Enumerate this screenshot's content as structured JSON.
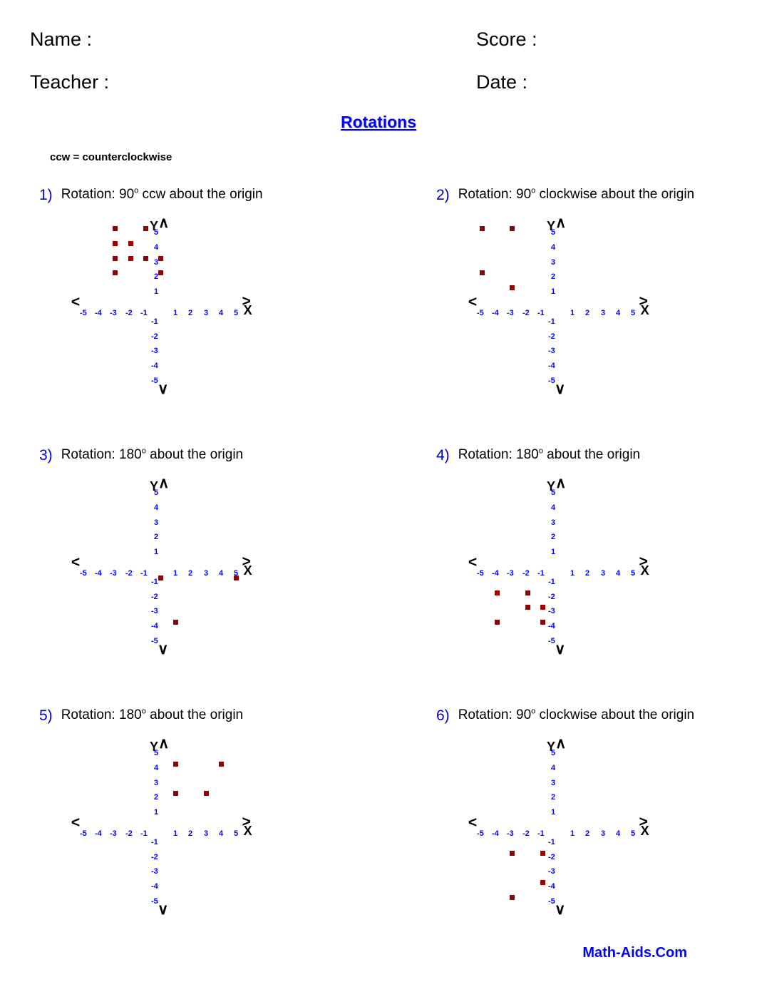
{
  "header": {
    "name_label": "Name :",
    "teacher_label": "Teacher :",
    "score_label": "Score :",
    "date_label": "Date :"
  },
  "title": "Rotations",
  "legend_note": "ccw = counterclockwise",
  "footer": "Math-Aids.Com",
  "colors": {
    "title": "#0000FF",
    "problem_number": "#0000CC",
    "tick_label": "#0000FF",
    "point_marker": "#990000",
    "axis": "#000000",
    "footer": "#0000FF"
  },
  "axis": {
    "x_letter": "X",
    "y_letter": "Y",
    "left_arrow": "<",
    "right_arrow": ">",
    "up_arrow": "∧",
    "down_arrow": "∨",
    "x_ticks": [
      "-5",
      "-4",
      "-3",
      "-2",
      "-1",
      "1",
      "2",
      "3",
      "4",
      "5"
    ],
    "y_ticks": [
      "5",
      "4",
      "3",
      "2",
      "1",
      "-1",
      "-2",
      "-3",
      "-4",
      "-5"
    ],
    "xlim": [
      -5,
      5
    ],
    "ylim": [
      -5,
      5
    ]
  },
  "problems": [
    {
      "number": "1)",
      "prefix": "Rotation: 90",
      "degree": "o",
      "suffix": " ccw about the origin",
      "text": "Rotation: 90° ccw about the origin"
    },
    {
      "number": "2)",
      "prefix": "Rotation: 90",
      "degree": "o",
      "suffix": " clockwise about the origin",
      "text": "Rotation: 90° clockwise about the origin"
    },
    {
      "number": "3)",
      "prefix": "Rotation: 180",
      "degree": "o",
      "suffix": " about the origin",
      "text": "Rotation: 180° about the origin"
    },
    {
      "number": "4)",
      "prefix": "Rotation: 180",
      "degree": "o",
      "suffix": " about the origin",
      "text": "Rotation: 180° about the origin"
    },
    {
      "number": "5)",
      "prefix": "Rotation: 180",
      "degree": "o",
      "suffix": " about the origin",
      "text": "Rotation: 180° about the origin"
    },
    {
      "number": "6)",
      "prefix": "Rotation: 90",
      "degree": "o",
      "suffix": " clockwise about the origin",
      "text": "Rotation: 90° clockwise about the origin"
    }
  ],
  "chart_data": [
    {
      "type": "scatter",
      "title": "Rotation: 90° ccw about the origin",
      "xlabel": "X",
      "ylabel": "Y",
      "xlim": [
        -5,
        5
      ],
      "ylim": [
        -5,
        5
      ],
      "grid": false,
      "legend": "none",
      "marker_color": "#990000",
      "points": [
        [
          -3,
          5
        ],
        [
          -1,
          5
        ],
        [
          -3,
          4
        ],
        [
          -2,
          4
        ],
        [
          -3,
          3
        ],
        [
          -2,
          3
        ],
        [
          -1,
          3
        ],
        [
          0,
          3
        ],
        [
          -3,
          2
        ],
        [
          0,
          2
        ]
      ]
    },
    {
      "type": "scatter",
      "title": "Rotation: 90° clockwise about the origin",
      "xlabel": "X",
      "ylabel": "Y",
      "xlim": [
        -5,
        5
      ],
      "ylim": [
        -5,
        5
      ],
      "grid": false,
      "legend": "none",
      "marker_color": "#990000",
      "points": [
        [
          -5,
          5
        ],
        [
          -3,
          5
        ],
        [
          -5,
          2
        ],
        [
          -3,
          1
        ]
      ]
    },
    {
      "type": "scatter",
      "title": "Rotation: 180° about the origin",
      "xlabel": "X",
      "ylabel": "Y",
      "xlim": [
        -5,
        5
      ],
      "ylim": [
        -5,
        5
      ],
      "grid": false,
      "legend": "none",
      "marker_color": "#990000",
      "points": [
        [
          0,
          -1
        ],
        [
          5,
          -1
        ],
        [
          1,
          -4
        ]
      ]
    },
    {
      "type": "scatter",
      "title": "Rotation: 180° about the origin",
      "xlabel": "X",
      "ylabel": "Y",
      "xlim": [
        -5,
        5
      ],
      "ylim": [
        -5,
        5
      ],
      "grid": false,
      "legend": "none",
      "marker_color": "#990000",
      "points": [
        [
          -4,
          -2
        ],
        [
          -2,
          -2
        ],
        [
          -2,
          -3
        ],
        [
          -1,
          -3
        ],
        [
          -4,
          -4
        ],
        [
          -1,
          -4
        ]
      ]
    },
    {
      "type": "scatter",
      "title": "Rotation: 180° about the origin",
      "xlabel": "X",
      "ylabel": "Y",
      "xlim": [
        -5,
        5
      ],
      "ylim": [
        -5,
        5
      ],
      "grid": false,
      "legend": "none",
      "marker_color": "#990000",
      "points": [
        [
          1,
          4
        ],
        [
          4,
          4
        ],
        [
          1,
          2
        ],
        [
          3,
          2
        ]
      ]
    },
    {
      "type": "scatter",
      "title": "Rotation: 90° clockwise about the origin",
      "xlabel": "X",
      "ylabel": "Y",
      "xlim": [
        -5,
        5
      ],
      "ylim": [
        -5,
        5
      ],
      "grid": false,
      "legend": "none",
      "marker_color": "#990000",
      "points": [
        [
          -3,
          -2
        ],
        [
          -1,
          -2
        ],
        [
          -1,
          -4
        ],
        [
          -3,
          -5
        ]
      ]
    }
  ]
}
